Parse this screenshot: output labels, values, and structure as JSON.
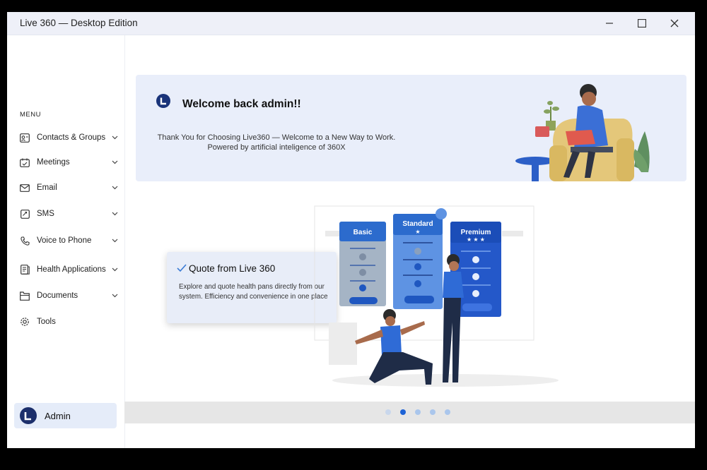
{
  "window": {
    "title": "Live 360 — Desktop Edition",
    "controls": [
      "minimize",
      "maximize",
      "close"
    ]
  },
  "sidebar": {
    "menu_label": "MENU",
    "items": [
      {
        "label": "Contacts & Groups",
        "icon": "contacts-icon"
      },
      {
        "label": "Meetings",
        "icon": "meetings-icon"
      },
      {
        "label": "Email",
        "icon": "email-icon"
      },
      {
        "label": "SMS",
        "icon": "sms-icon"
      },
      {
        "label": "Voice to Phone",
        "icon": "phone-icon"
      },
      {
        "label": "Health Applications",
        "icon": "health-icon"
      },
      {
        "label": "Documents",
        "icon": "documents-icon"
      },
      {
        "label": "Tools",
        "icon": "gear-icon"
      }
    ],
    "user": {
      "name": "Admin",
      "avatar_letter": "L"
    }
  },
  "banner": {
    "logo_letter": "L",
    "welcome": "Welcome back admin!!",
    "line1": "Thank You for Choosing Live360 — Welcome to a New Way to Work.",
    "line2": "Powered by artificial inteligence of 360X"
  },
  "feature_card": {
    "title": "Quote from Live 360",
    "text": "Explore and quote health pans directly from our system. Efficiency and convenience in one place"
  },
  "plans": [
    {
      "name": "Basic",
      "stars": 0
    },
    {
      "name": "Standard",
      "stars": 1
    },
    {
      "name": "Premium",
      "stars": 3
    }
  ],
  "carousel": {
    "count": 5,
    "active_index": 1
  },
  "colors": {
    "accent": "#1e63d6",
    "banner_bg": "#e9eefa",
    "brand_dark": "#1a347a"
  }
}
